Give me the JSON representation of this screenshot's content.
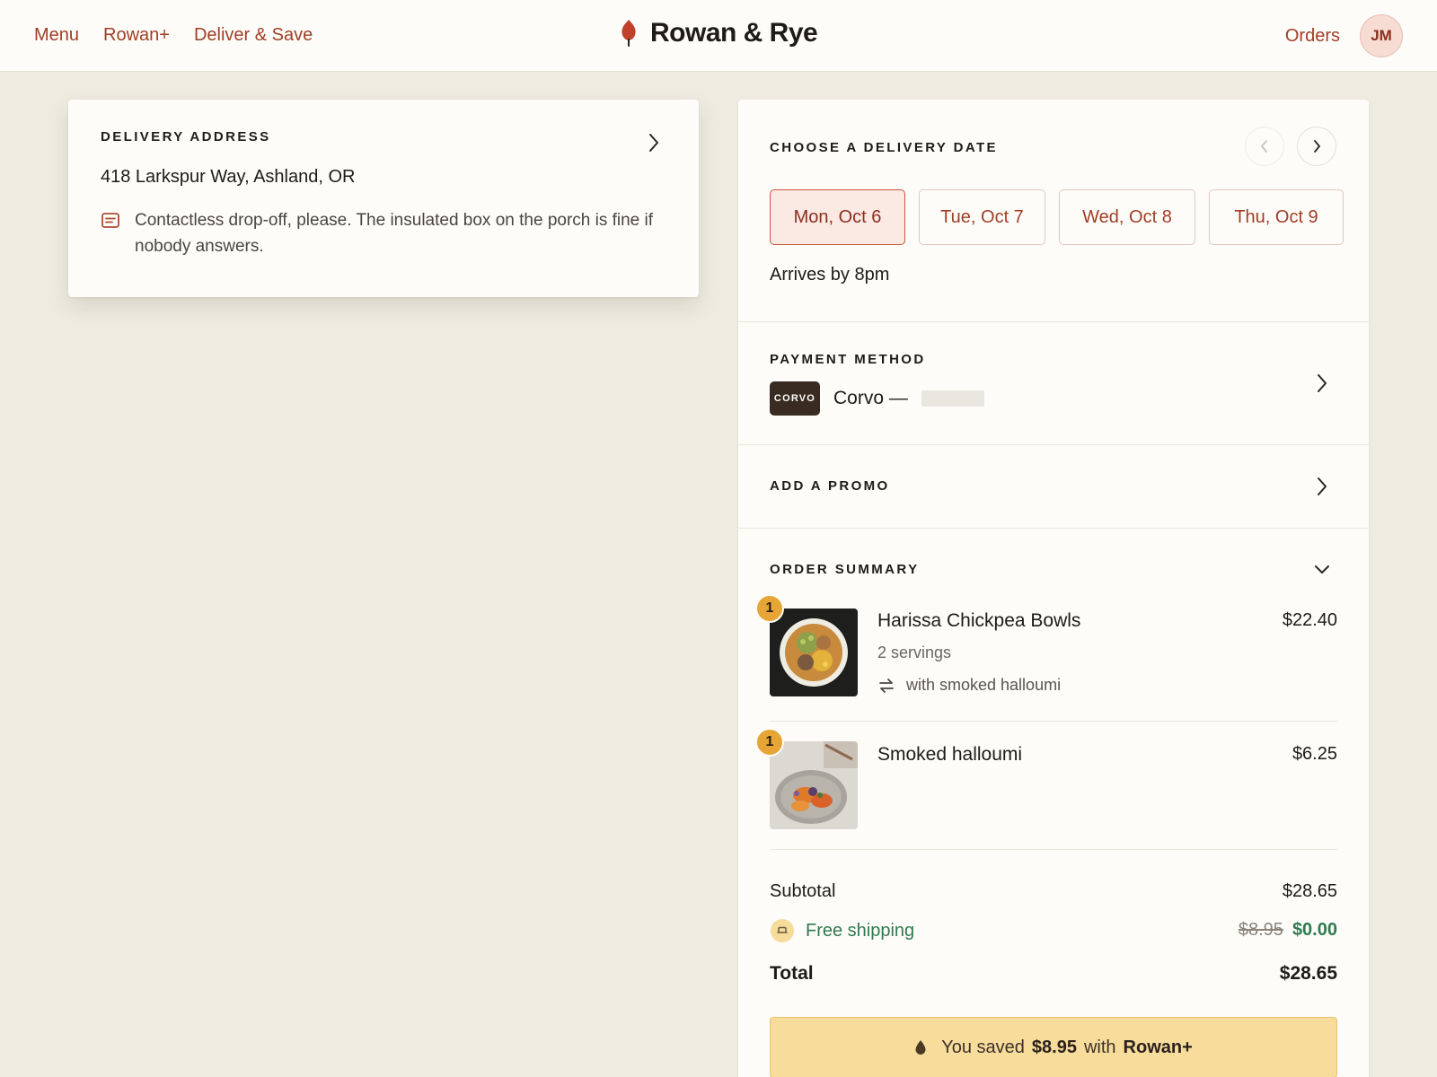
{
  "nav": {
    "menu": "Menu",
    "rowan_plus": "Rowan+",
    "deliver_save": "Deliver & Save",
    "brand": "Rowan & Rye",
    "orders": "Orders",
    "avatar_initials": "JM"
  },
  "address": {
    "title": "Delivery Address",
    "line": "418 Larkspur Way, Ashland, OR",
    "note": "Contactless drop-off, please. The insulated box on the porch is fine if nobody answers."
  },
  "delivery": {
    "title": "Choose a Delivery Date",
    "dates": [
      {
        "label": "Mon, Oct 6",
        "selected": true
      },
      {
        "label": "Tue, Oct 7",
        "selected": false
      },
      {
        "label": "Wed, Oct 8",
        "selected": false
      },
      {
        "label": "Thu, Oct 9",
        "selected": false
      }
    ],
    "arrives": "Arrives by 8pm"
  },
  "payment": {
    "title": "Payment Method",
    "badge": "CORVO",
    "label": "Corvo —"
  },
  "promo": {
    "title": "Add a Promo"
  },
  "summary": {
    "title": "Order Summary",
    "items": [
      {
        "qty": "1",
        "name": "Harissa Chickpea Bowls",
        "price": "$22.40",
        "servings": "2 servings",
        "swap": "with smoked halloumi"
      },
      {
        "qty": "1",
        "name": "Smoked halloumi",
        "price": "$6.25"
      }
    ],
    "subtotal_label": "Subtotal",
    "subtotal": "$28.65",
    "shipping_label": "Free shipping",
    "shipping_original": "$8.95",
    "shipping": "$0.00",
    "total_label": "Total",
    "total": "$28.65"
  },
  "savings": {
    "prefix": "You saved",
    "amount": "$8.95",
    "middle": "with",
    "program": "Rowan+"
  },
  "colors": {
    "accent": "#a03e25",
    "background": "#eeebe1",
    "surface": "#fdfcf9",
    "success": "#2f7a4f",
    "savings_bar": "#f7dc9c",
    "qty_badge": "#e7a536"
  }
}
